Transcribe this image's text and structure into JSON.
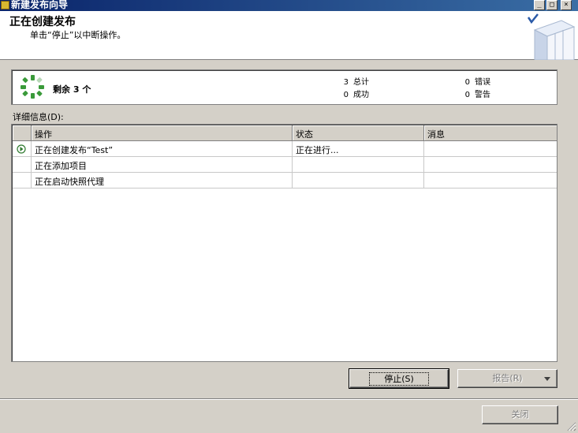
{
  "window": {
    "title": "新建发布向导",
    "min_glyph": "_",
    "max_glyph": "□",
    "close_glyph": "×"
  },
  "header": {
    "title": "正在创建发布",
    "subtitle": "单击“停止”以中断操作。"
  },
  "summary": {
    "remaining_text": "剩余 3 个",
    "total_count": "3",
    "total_label": "总计",
    "success_count": "0",
    "success_label": "成功",
    "error_count": "0",
    "error_label": "错误",
    "warning_count": "0",
    "warning_label": "警告"
  },
  "details": {
    "label": "详细信息(D):",
    "columns": [
      "操作",
      "状态",
      "消息"
    ],
    "rows": [
      {
        "action": "正在创建发布“Test”",
        "status": "正在进行...",
        "message": "",
        "icon": "in-progress-arrow-icon"
      },
      {
        "action": "正在添加项目",
        "status": "",
        "message": "",
        "icon": ""
      },
      {
        "action": "正在启动快照代理",
        "status": "",
        "message": "",
        "icon": ""
      }
    ]
  },
  "buttons": {
    "stop": "停止(S)",
    "report": "报告(R)",
    "close": "关闭"
  },
  "colors": {
    "spinner_green": "#3a9a3a",
    "title_bar": "#0a246a"
  }
}
